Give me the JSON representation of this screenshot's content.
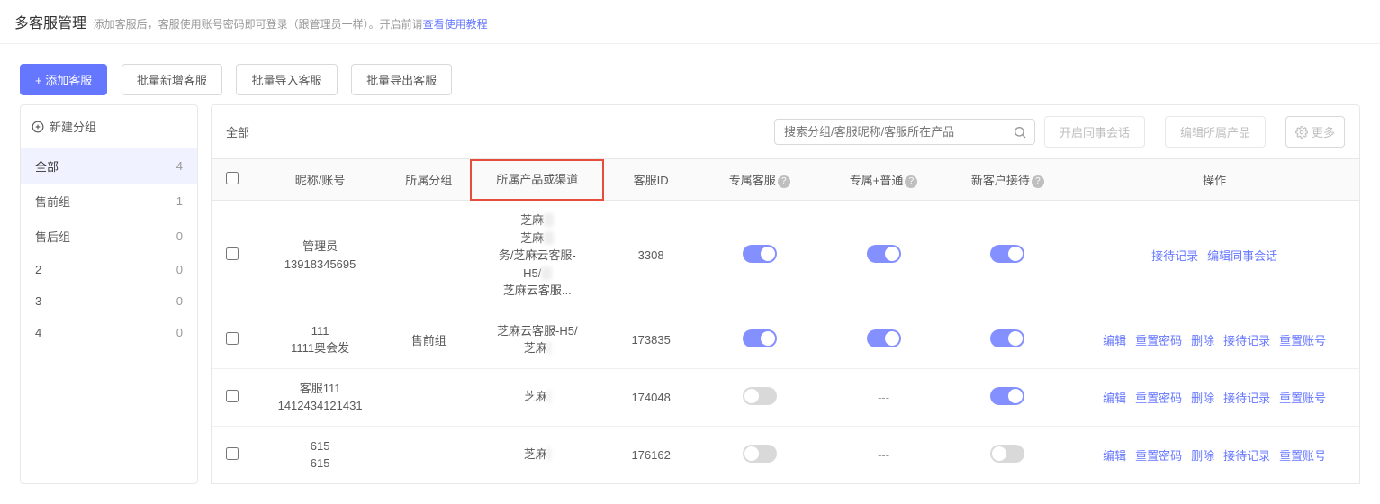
{
  "header": {
    "title": "多客服管理",
    "desc_prefix": "添加客服后，客服使用账号密码即可登录（跟管理员一样）。开启前请",
    "desc_link": "查看使用教程"
  },
  "toolbar": {
    "add": "+ 添加客服",
    "batch_add": "批量新增客服",
    "batch_import": "批量导入客服",
    "batch_export": "批量导出客服"
  },
  "sidebar": {
    "new_group": "新建分组",
    "items": [
      {
        "label": "全部",
        "count": "4",
        "active": true
      },
      {
        "label": "售前组",
        "count": "1"
      },
      {
        "label": "售后组",
        "count": "0"
      },
      {
        "label": "2",
        "count": "0"
      },
      {
        "label": "3",
        "count": "0"
      },
      {
        "label": "4",
        "count": "0"
      }
    ]
  },
  "main": {
    "breadcrumb": "全部",
    "search_placeholder": "搜索分组/客服昵称/客服所在产品",
    "btn_open_session": "开启同事会话",
    "btn_edit_product": "编辑所属产品",
    "btn_more": "更多"
  },
  "table": {
    "headers": {
      "nickname": "昵称/账号",
      "group": "所属分组",
      "product": "所属产品或渠道",
      "cs_id": "客服ID",
      "exclusive": "专属客服",
      "exclusive_normal": "专属+普通",
      "new_customer": "新客户接待",
      "ops": "操作"
    },
    "rows": [
      {
        "nick1": "管理员",
        "nick2": "13918345695",
        "group": "",
        "product_lines": [
          "芝麻",
          "芝麻",
          "务/芝麻云客服-",
          "H5/",
          "芝麻云客服..."
        ],
        "product_mask": [
          "     /",
          "     /",
          "",
          "     /",
          ""
        ],
        "cs_id": "3308",
        "t1": true,
        "t2": true,
        "t3": true,
        "ops": [
          "接待记录",
          "编辑同事会话"
        ]
      },
      {
        "nick1": "111",
        "nick2": "1111奥会发",
        "group": "售前组",
        "product_lines": [
          "芝麻云客服-H5/",
          "芝麻"
        ],
        "product_mask": [
          "",
          "     "
        ],
        "cs_id": "173835",
        "t1": true,
        "t2": true,
        "t3": true,
        "ops": [
          "编辑",
          "重置密码",
          "删除",
          "接待记录",
          "重置账号"
        ]
      },
      {
        "nick1": "客服111",
        "nick2": "1412434121431",
        "group": "",
        "product_lines": [
          "芝麻"
        ],
        "product_mask": [
          "     "
        ],
        "cs_id": "174048",
        "t1": false,
        "t2": null,
        "t3": true,
        "ops": [
          "编辑",
          "重置密码",
          "删除",
          "接待记录",
          "重置账号"
        ]
      },
      {
        "nick1": "615",
        "nick2": "615",
        "group": "",
        "product_lines": [
          "芝麻"
        ],
        "product_mask": [
          "     "
        ],
        "cs_id": "176162",
        "t1": false,
        "t2": null,
        "t3": false,
        "ops": [
          "编辑",
          "重置密码",
          "删除",
          "接待记录",
          "重置账号"
        ]
      }
    ]
  }
}
